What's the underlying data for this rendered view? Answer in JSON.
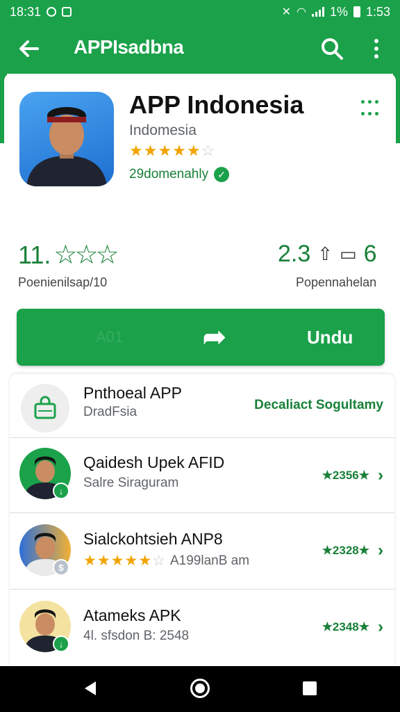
{
  "status_bar": {
    "time_left": "18:31",
    "battery_pct": "1%",
    "time_right": "1:53"
  },
  "app_bar": {
    "title": "APPIsadbna"
  },
  "app": {
    "name": "APP Indonesia",
    "developer": "Indomesia",
    "rating_stars": 4.5,
    "installs_text": "29domenahly"
  },
  "stats": {
    "rating_value": "11.",
    "rating_label": "Poenienilsap/10",
    "right_value": "2.3",
    "right_suffix": "6",
    "right_label": "Popennahelan"
  },
  "install_button": {
    "ghost_label": "A01",
    "label": "Undu"
  },
  "list": [
    {
      "title": "Pnthoeal APP",
      "subtitle": "DradFsia",
      "right_text": "Decaliact Sogultamy"
    },
    {
      "title": "Qaidesh Upek AFID",
      "subtitle": "Salre Siraguram",
      "right_text": "★2356★"
    },
    {
      "title": "Sialckohtsieh ANP8",
      "subtitle": "A199lanB am",
      "rating_stars": 4.5,
      "right_text": "★2328★"
    },
    {
      "title": "Atameks APK",
      "subtitle": "4l. sfsdon B: 2548",
      "right_text": "★2348★"
    }
  ],
  "colors": {
    "brand_green": "#1aa14a",
    "dark_green": "#188038",
    "star_gold": "#f2a300"
  }
}
